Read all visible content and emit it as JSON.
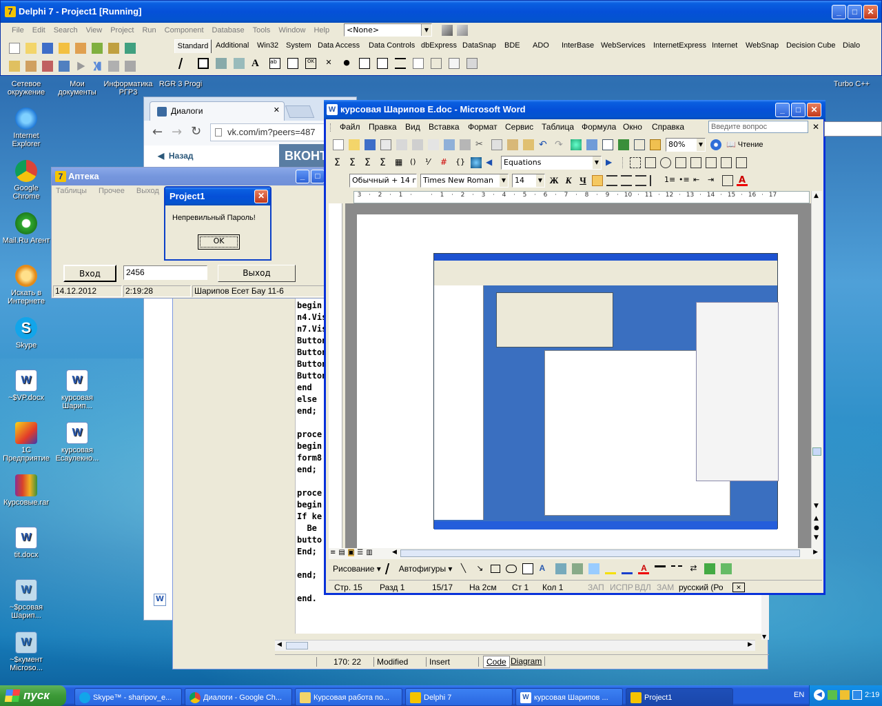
{
  "delphi": {
    "title": "Delphi 7 - Project1 [Running]",
    "menu": [
      "File",
      "Edit",
      "Search",
      "View",
      "Project",
      "Run",
      "Component",
      "Database",
      "Tools",
      "Window",
      "Help"
    ],
    "combo": "<None>",
    "palette_tabs": [
      "Standard",
      "Additional",
      "Win32",
      "System",
      "Data Access",
      "Data Controls",
      "dbExpress",
      "DataSnap",
      "BDE",
      "ADO",
      "InterBase",
      "WebServices",
      "InternetExpress",
      "Internet",
      "WebSnap",
      "Decision Cube",
      "Dialo"
    ]
  },
  "desktop": {
    "icons": [
      {
        "label": "Сетевое окружение"
      },
      {
        "label": "Мои документы"
      },
      {
        "label": "Информатика РГР3"
      },
      {
        "label": "RGR 3 Progi"
      },
      {
        "label": "Turbo C++"
      },
      {
        "label": "Internet Explorer"
      },
      {
        "label": "Google Chrome"
      },
      {
        "label": "Mail.Ru Агент"
      },
      {
        "label": "Искать в Интернете"
      },
      {
        "label": "Skype"
      },
      {
        "label": "~$VP.docx"
      },
      {
        "label": "курсовая Шарип..."
      },
      {
        "label": "1С Предприятие"
      },
      {
        "label": "курсовая Есаулекно..."
      },
      {
        "label": "Курсовые.rar"
      },
      {
        "label": "tit.docx"
      },
      {
        "label": "~$рсовая Шарип..."
      },
      {
        "label": "~$кумент Microso..."
      }
    ]
  },
  "browser": {
    "tab": "Диалоги",
    "url": "vk.com/im?peers=487",
    "back": "Назад",
    "logo": "ВКОНТ"
  },
  "editor": {
    "lines": [
      {
        "code": "begin",
        "bp": false
      },
      {
        "code": "n4.Visi",
        "bp": true
      },
      {
        "code": "n7.Visi",
        "bp": true
      },
      {
        "code": "Button",
        "bp": true
      },
      {
        "code": "Button",
        "bp": true
      },
      {
        "code": "Button",
        "bp": true
      },
      {
        "code": "Button",
        "bp": true
      },
      {
        "code": "end",
        "bp": false
      },
      {
        "code": "else",
        "bp": true
      },
      {
        "code": "end;",
        "bp": true
      },
      {
        "code": "",
        "bp": false
      },
      {
        "code": "proce",
        "bp": false
      },
      {
        "code": "begin",
        "bp": false
      },
      {
        "code": "form8",
        "bp": true
      },
      {
        "code": "end;",
        "bp": true
      },
      {
        "code": "",
        "bp": false
      },
      {
        "code": "proce",
        "bp": false
      },
      {
        "code": "begin",
        "bp": false
      },
      {
        "code": "If ke",
        "bp": true
      },
      {
        "code": "  Be",
        "bp": false
      },
      {
        "code": "butto",
        "bp": true
      },
      {
        "code": "End;",
        "bp": true
      },
      {
        "code": "",
        "bp": false
      },
      {
        "code": "end;",
        "bp": true
      },
      {
        "code": "",
        "bp": false
      },
      {
        "code": "end.",
        "bp": true
      }
    ],
    "status": {
      "pos": "170: 22",
      "modified": "Modified",
      "mode": "Insert",
      "tab_code": "Code",
      "tab_diagram": "Diagram"
    }
  },
  "apteka": {
    "title": "Аптека",
    "menu": [
      "Таблицы",
      "Прочее",
      "Выход"
    ],
    "login": "Вход",
    "password": "2456",
    "exit": "Выход",
    "status": [
      "14.12.2012",
      "2:19:28",
      "Шарипов Есет Бау 11-6"
    ]
  },
  "dialog": {
    "title": "Project1",
    "message": "Непревильный Пароль!",
    "ok": "OK"
  },
  "word": {
    "title": "курсовая Шарипов Е.doc - Microsoft Word",
    "menu": [
      "Файл",
      "Правка",
      "Вид",
      "Вставка",
      "Формат",
      "Сервис",
      "Таблица",
      "Формула",
      "Окно",
      "Справка"
    ],
    "help_placeholder": "Введите вопрос",
    "zoom": "80%",
    "reading": "Чтение",
    "equations": "Equations",
    "style": "Обычный + 14 г",
    "font": "Times New Roman",
    "size": "14",
    "draw": {
      "drawing": "Рисование",
      "autoshapes": "Автофигуры"
    },
    "status": [
      "Стр.  15",
      "Разд  1",
      "15/17",
      "На  2см",
      "Ст  1",
      "Кол  1",
      "ЗАП",
      "ИСПР",
      "ВДЛ",
      "ЗАМ",
      "русский (Ро"
    ]
  },
  "taskbar": {
    "start": "пуск",
    "items": [
      "Skype™ - sharipov_e...",
      "Диалоги - Google Ch...",
      "Курсовая работа по...",
      "Delphi 7",
      "курсовая Шарипов ...",
      "Project1"
    ],
    "lang": "EN",
    "time": "2:19"
  },
  "colors": {
    "xp_blue": "#0550d8",
    "face": "#ece9d8",
    "taskbar": "#245edb",
    "start": "#3c9a37"
  }
}
